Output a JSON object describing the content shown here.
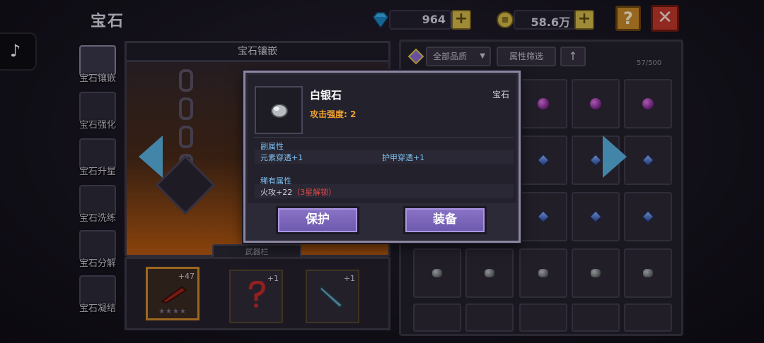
{
  "header": {
    "title": "宝石"
  },
  "currency": {
    "diamond": {
      "value": "964",
      "icon": "diamond-icon"
    },
    "gold": {
      "value": "58.6万",
      "icon": "coin-icon"
    },
    "plus_label": "+"
  },
  "top_buttons": {
    "help": "?",
    "close": "✕"
  },
  "sidebar": {
    "items": [
      {
        "label": "宝石镶嵌",
        "active": true
      },
      {
        "label": "宝石强化"
      },
      {
        "label": "宝石升星"
      },
      {
        "label": "宝石洗练"
      },
      {
        "label": "宝石分解"
      },
      {
        "label": "宝石凝结"
      }
    ]
  },
  "socket_panel": {
    "title": "宝石镶嵌",
    "weapon_bar_label": "武器栏"
  },
  "weapons": [
    {
      "bonus": "+47",
      "stars": "★★★★",
      "selected": true
    },
    {
      "bonus": "+1"
    },
    {
      "bonus": "+1"
    }
  ],
  "inventory": {
    "quality_filter": "全部品质",
    "attr_filter": "属性筛选",
    "sort_icon": "↑",
    "count": "57/500"
  },
  "popup": {
    "gem_name": "白银石",
    "attack": "攻击强度: 2",
    "type": "宝石",
    "sub_attr_title": "副属性",
    "sub_attrs": [
      "元素穿透+1",
      "护甲穿透+1"
    ],
    "rare_attr_title": "稀有属性",
    "rare_attr": "火攻+22",
    "rare_attr_lock": "（3星解锁）",
    "btn_protect": "保护",
    "btn_equip": "装备"
  },
  "colors": {
    "accent_button": "#7a64b8",
    "attack_text": "#f0a030",
    "attr_text": "#7ec2f2",
    "lock_text": "#e04848"
  }
}
